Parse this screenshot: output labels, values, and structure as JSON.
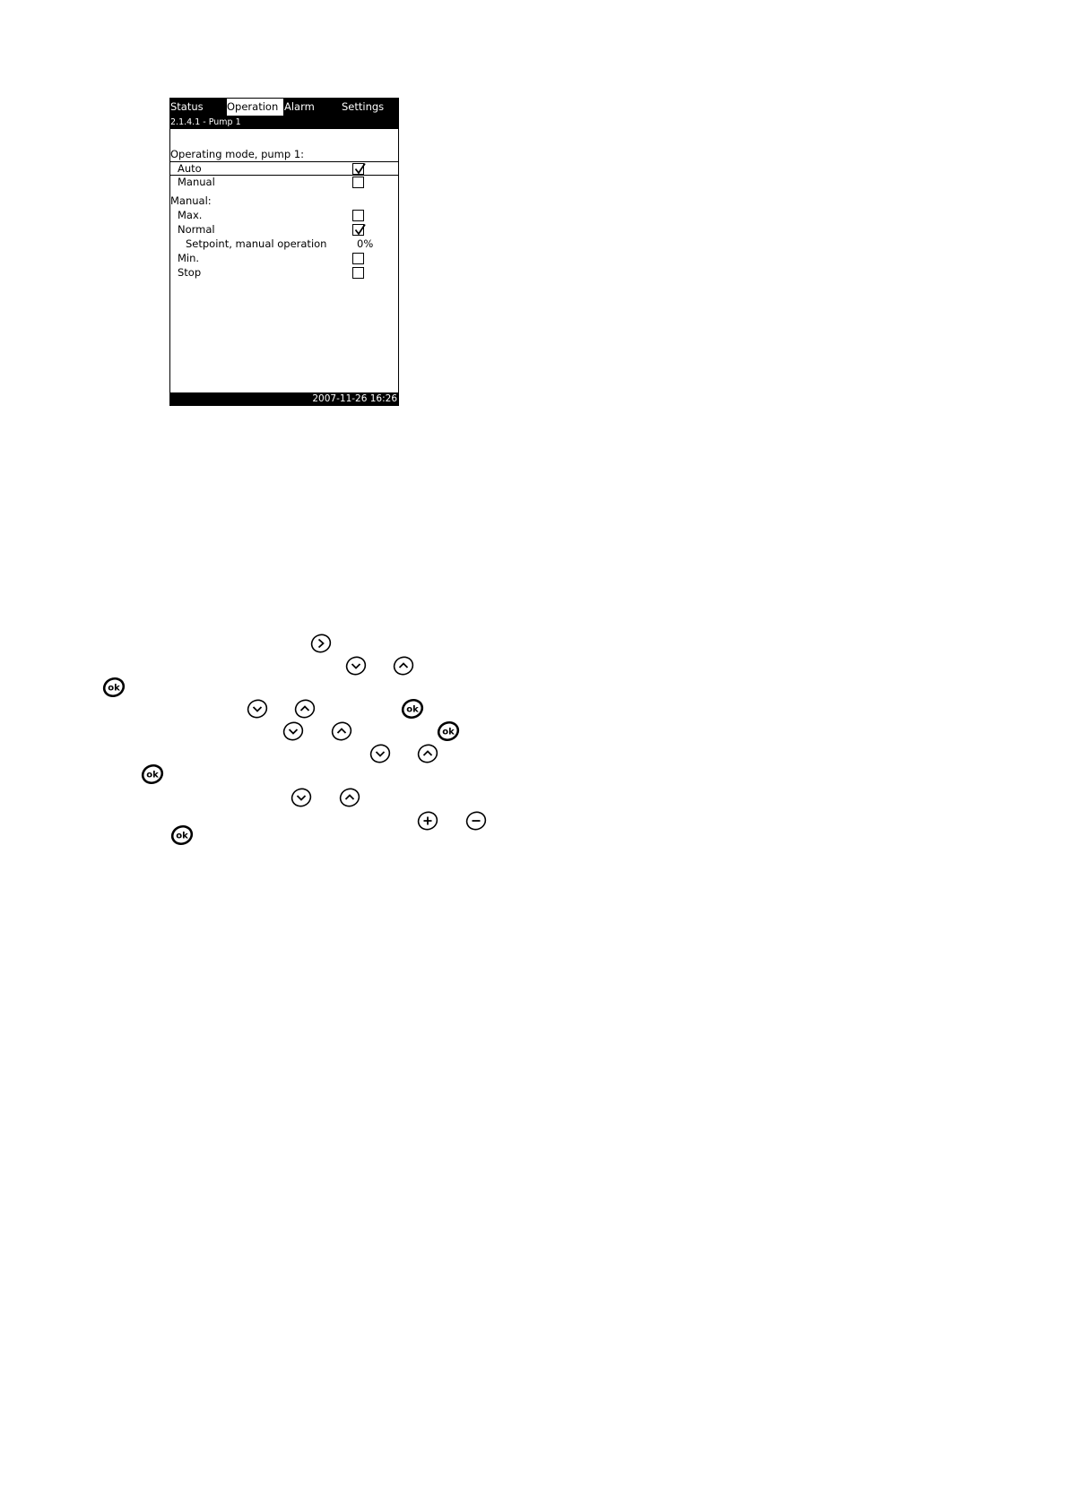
{
  "lcd": {
    "tabs": [
      {
        "label": "Status"
      },
      {
        "label": "Operation"
      },
      {
        "label": "Alarm"
      },
      {
        "label": "Settings"
      }
    ],
    "active_tab": "Operation",
    "breadcrumb": "2.1.4.1 - Pump 1",
    "operating_mode_heading": "Operating mode, pump 1:",
    "modes": [
      {
        "label": "Auto",
        "checked": true
      },
      {
        "label": "Manual",
        "checked": false
      }
    ],
    "manual_heading": "Manual:",
    "manual_options": [
      {
        "label": "Max.",
        "checked": false
      },
      {
        "label": "Normal",
        "checked": true
      },
      {
        "label": "Setpoint, manual operation",
        "value": "0%"
      },
      {
        "label": "Min.",
        "checked": false
      },
      {
        "label": "Stop",
        "checked": false
      }
    ],
    "datetime": "2007-11-26  16:26"
  },
  "keys": [
    {
      "icon": "right-arrow-key"
    },
    {
      "icon": "down-arrow-key"
    },
    {
      "icon": "up-arrow-key"
    },
    {
      "icon": "ok-key"
    },
    {
      "icon": "down-arrow-key"
    },
    {
      "icon": "up-arrow-key"
    },
    {
      "icon": "ok-key"
    },
    {
      "icon": "down-arrow-key"
    },
    {
      "icon": "up-arrow-key"
    },
    {
      "icon": "ok-key"
    },
    {
      "icon": "down-arrow-key"
    },
    {
      "icon": "up-arrow-key"
    },
    {
      "icon": "ok-key"
    },
    {
      "icon": "down-arrow-key"
    },
    {
      "icon": "up-arrow-key"
    },
    {
      "icon": "plus-key"
    },
    {
      "icon": "minus-key"
    },
    {
      "icon": "ok-key"
    }
  ]
}
